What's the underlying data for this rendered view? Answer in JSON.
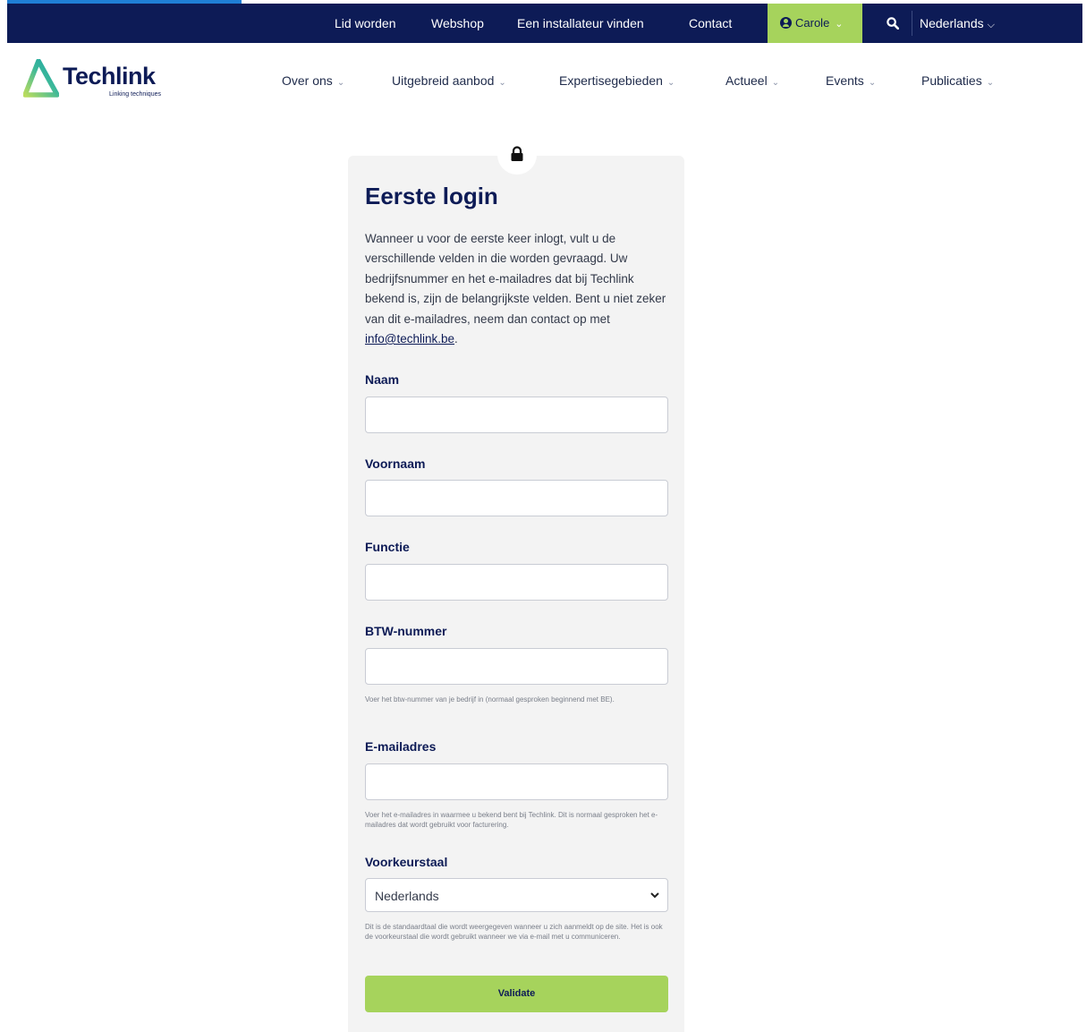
{
  "topbar": {
    "links": [
      "Lid worden",
      "Webshop",
      "Een installateur vinden",
      "Contact"
    ],
    "user": "Carole",
    "language": "Nederlands"
  },
  "logo": {
    "name": "Techlink",
    "tagline": "Linking techniques"
  },
  "nav": {
    "items": [
      "Over ons",
      "Uitgebreid aanbod",
      "Expertisegebieden",
      "Actueel",
      "Events",
      "Publicaties"
    ]
  },
  "form": {
    "title": "Eerste login",
    "intro": "Wanneer u voor de eerste keer inlogt, vult u de verschillende velden in die worden gevraagd. Uw bedrijfsnummer en het e-mailadres dat bij Techlink bekend is, zijn de belangrijkste velden. Bent u niet zeker van dit e-mailadres, neem dan contact op met ",
    "intro_link": "info@techlink.be",
    "intro_end": ".",
    "fields": {
      "naam": {
        "label": "Naam",
        "value": ""
      },
      "voornaam": {
        "label": "Voornaam",
        "value": ""
      },
      "functie": {
        "label": "Functie",
        "value": ""
      },
      "btw": {
        "label": "BTW-nummer",
        "value": "",
        "hint": "Voer het btw-nummer van je bedrijf in (normaal gesproken beginnend met BE)."
      },
      "email": {
        "label": "E-mailadres",
        "value": "",
        "hint": "Voer het e-mailadres in waarmee u bekend bent bij Techlink. Dit is normaal gesproken het e-mailadres dat wordt gebruikt voor facturering."
      },
      "taal": {
        "label": "Voorkeurstaal",
        "value": "Nederlands",
        "hint": "Dit is de standaardtaal die wordt weergegeven wanneer u zich aanmeldt op de site. Het is ook de voorkeurstaal die wordt gebruikt wanneer we via e-mail met u communiceren."
      }
    },
    "submit": "Validate"
  },
  "colors": {
    "navy": "#0d1b56",
    "green": "#a6d35c",
    "card": "#f3f3f3"
  },
  "icons": [
    "user-icon",
    "search-icon",
    "chevron-down-icon",
    "lock-icon",
    "techlink-logo"
  ]
}
